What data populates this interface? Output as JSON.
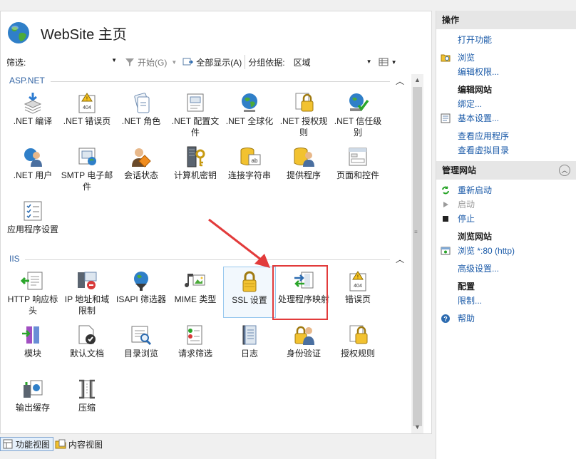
{
  "header": {
    "title": "WebSite 主页"
  },
  "toolbar": {
    "filter_label": "筛选:",
    "start_label": "开始(G)",
    "show_all_label": "全部显示(A)",
    "group_label": "分组依据:",
    "group_value": "区域"
  },
  "sections": {
    "aspnet": "ASP.NET",
    "iis": "IIS"
  },
  "tiles": {
    "net_compile": ".NET 编译",
    "net_error": ".NET 错误页",
    "net_role": ".NET 角色",
    "net_config": ".NET 配置文件",
    "net_global": ".NET 全球化",
    "net_authz": ".NET 授权规则",
    "net_trust": ".NET 信任级别",
    "net_users": ".NET 用户",
    "smtp": "SMTP 电子邮件",
    "session": "会话状态",
    "machine_key": "计算机密钥",
    "conn_str": "连接字符串",
    "providers": "提供程序",
    "pages": "页面和控件",
    "app_settings": "应用程序设置",
    "http_resp": "HTTP 响应标头",
    "ip_domain": "IP 地址和域限制",
    "isapi": "ISAPI 筛选器",
    "mime": "MIME 类型",
    "ssl": "SSL 设置",
    "handler": "处理程序映射",
    "error_pages": "错误页",
    "modules": "模块",
    "default_doc": "默认文档",
    "dir_browse": "目录浏览",
    "req_filter": "请求筛选",
    "logging": "日志",
    "auth": "身份验证",
    "authz_rules": "授权规则",
    "output_cache": "输出缓存",
    "compression": "压缩"
  },
  "bottom": {
    "features_view": "功能视图",
    "content_view": "内容视图"
  },
  "actions": {
    "title": "操作",
    "open_feature": "打开功能",
    "browse": "浏览",
    "edit_perms": "编辑权限...",
    "edit_site": "编辑网站",
    "bindings": "绑定...",
    "basic_settings": "基本设置...",
    "view_apps": "查看应用程序",
    "view_vdirs": "查看虚拟目录",
    "manage_site": "管理网站",
    "restart": "重新启动",
    "start": "启动",
    "stop": "停止",
    "browse_site": "浏览网站",
    "browse_80": "浏览 *:80 (http)",
    "advanced": "高级设置...",
    "config": "配置",
    "limits": "限制...",
    "help": "帮助"
  },
  "colors": {
    "accent_link": "#1a5aa8",
    "section_head": "#3465a4",
    "highlight_box": "#e23b3b",
    "arrow": "#e23b3b"
  }
}
